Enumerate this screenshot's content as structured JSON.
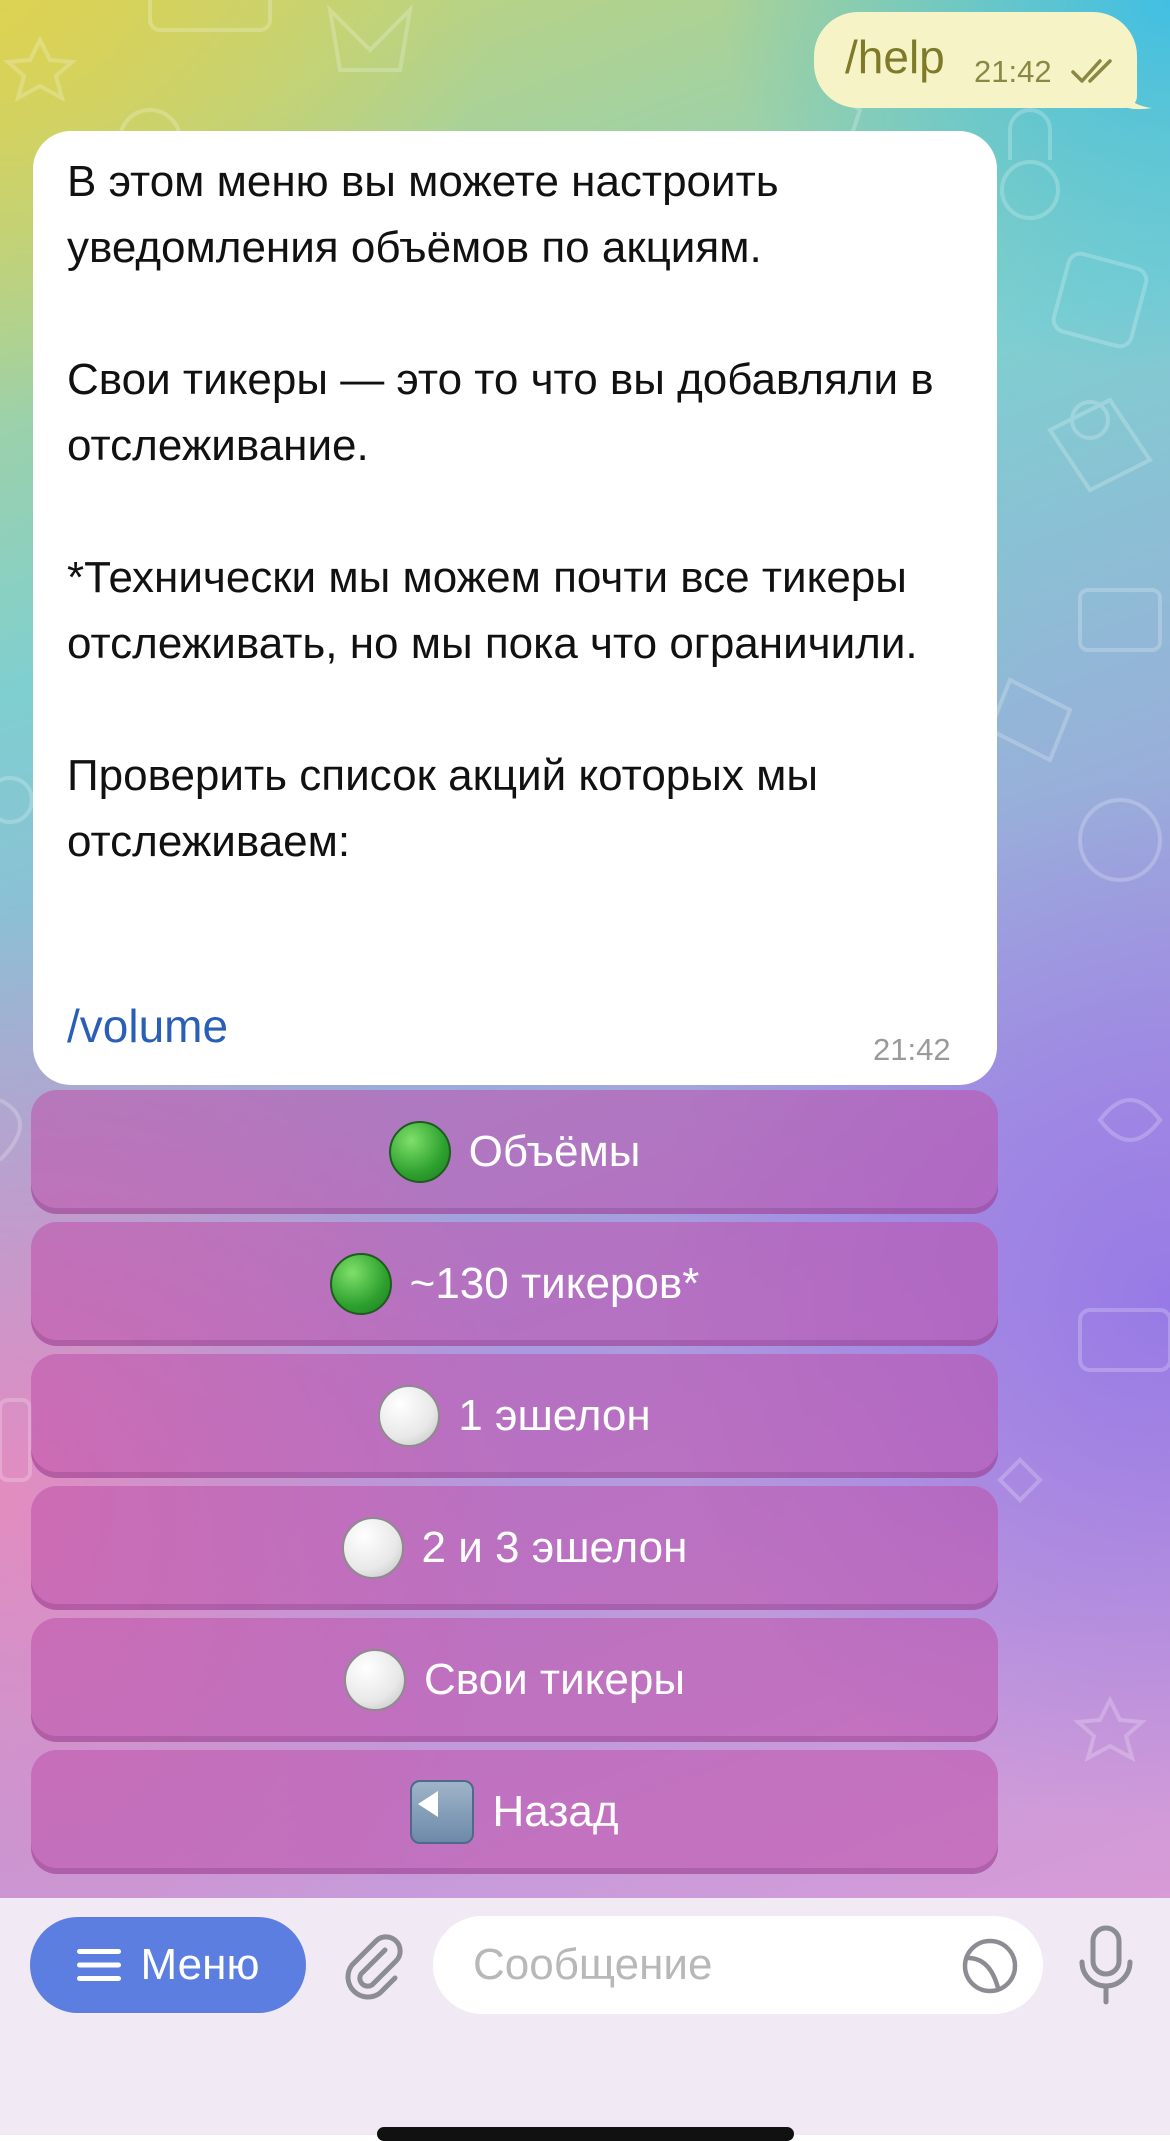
{
  "outgoing_message": {
    "text": "/help",
    "time": "21:42",
    "status_icon": "double-check-icon"
  },
  "incoming_message": {
    "text": "В этом меню вы можете настроить уведомления объёмов по акциям.\n\nСвои тикеры — это то что вы добавляли в отслеживание.\n\n*Технически мы можем почти все тикеры отслеживать, но мы пока что ограничили.\n\nПроверить список акций которых мы отслеживаем:",
    "link": "/volume",
    "time": "21:42"
  },
  "inline_keyboard": [
    {
      "icon": "green-circle-icon",
      "label": "Объёмы"
    },
    {
      "icon": "green-circle-icon",
      "label": "~130 тикеров*"
    },
    {
      "icon": "white-circle-icon",
      "label": "1 эшелон"
    },
    {
      "icon": "white-circle-icon",
      "label": "2 и 3 эшелон"
    },
    {
      "icon": "white-circle-icon",
      "label": "Свои тикеры"
    },
    {
      "icon": "back-arrow-icon",
      "label": "Назад"
    }
  ],
  "input_bar": {
    "menu_label": "Меню",
    "placeholder": "Сообщение"
  },
  "colors": {
    "menu_button": "#5b7ee0",
    "link": "#2a5fb8",
    "outgoing_bubble": "#f6f4c7"
  }
}
